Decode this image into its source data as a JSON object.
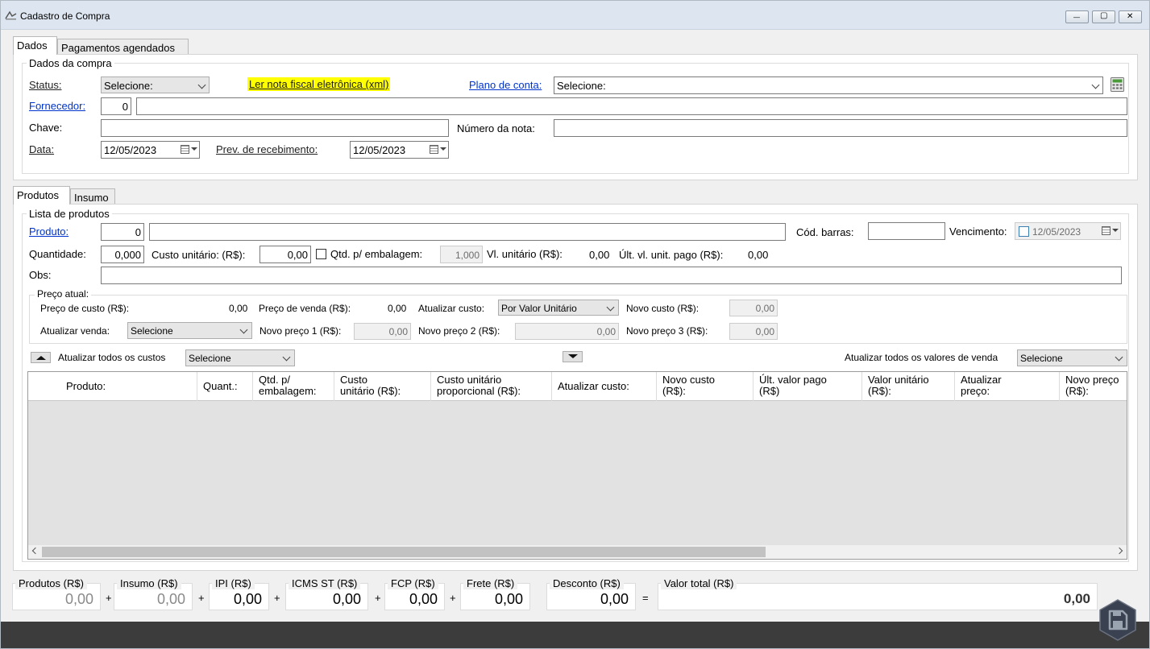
{
  "window": {
    "title": "Cadastro de Compra",
    "minimize_glyph": "—",
    "maximize_glyph": "▢",
    "close_glyph": "✕",
    "icon": "app-logo-icon"
  },
  "tabs_top": [
    "Dados",
    "Pagamentos agendados"
  ],
  "dados_compra": {
    "legend": "Dados da compra",
    "status_label": "Status:",
    "status_value": "Selecione:",
    "xml_link": "Ler nota fiscal eletrônica (xml)",
    "xml_highlight_color": "#ffff00",
    "plano_label": "Plano de conta:",
    "plano_value": "Selecione:",
    "fornecedor_label": "Fornecedor:",
    "fornecedor_code": "0",
    "fornecedor_name": "",
    "chave_label": "Chave:",
    "chave_value": "",
    "numero_label": "Número da nota:",
    "numero_value": "",
    "data_label": "Data:",
    "data_value": "12/05/2023",
    "prev_label": "Prev. de recebimento:",
    "prev_value": "12/05/2023"
  },
  "tabs_products": [
    "Produtos",
    "Insumo"
  ],
  "lista": {
    "legend": "Lista de produtos",
    "produto_label": "Produto:",
    "produto_code": "0",
    "produto_name": "",
    "cod_barras_label": "Cód. barras:",
    "cod_barras_value": "",
    "vencimento_label": "Vencimento:",
    "vencimento_value": "12/05/2023",
    "quantidade_label": "Quantidade:",
    "quantidade_value": "0,000",
    "custo_label": "Custo unitário: (R$):",
    "custo_value": "0,00",
    "qtd_emb_label": "Qtd. p/ embalagem:",
    "qtd_emb_value": "1,000",
    "vl_unit_label": "Vl. unitário (R$):",
    "vl_unit_value": "0,00",
    "ult_vl_label": "Últ. vl. unit. pago (R$):",
    "ult_vl_value": "0,00",
    "obs_label": "Obs:",
    "obs_value": ""
  },
  "preco_atual": {
    "legend": "Preço atual:",
    "preco_custo_label": "Preço de custo (R$):",
    "preco_custo_value": "0,00",
    "preco_venda_label": "Preço de venda (R$):",
    "preco_venda_value": "0,00",
    "atualizar_custo_label": "Atualizar custo:",
    "atualizar_custo_value": "Por Valor Unitário",
    "novo_custo_label": "Novo custo (R$):",
    "novo_custo_value": "0,00",
    "atualizar_venda_label": "Atualizar venda:",
    "atualizar_venda_value": "Selecione",
    "novo_preco1_label": "Novo preço 1 (R$):",
    "novo_preco1_value": "0,00",
    "novo_preco2_label": "Novo preço 2 (R$):",
    "novo_preco2_value": "0,00",
    "novo_preco3_label": "Novo preço 3 (R$):",
    "novo_preco3_value": "0,00"
  },
  "bulk": {
    "atualizar_custos_label": "Atualizar todos os custos",
    "atualizar_custos_value": "Selecione",
    "atualizar_valores_label": "Atualizar todos os valores de venda",
    "atualizar_valores_value": "Selecione"
  },
  "grid": {
    "columns": [
      [
        "Produto:"
      ],
      [
        "Quant.:"
      ],
      [
        "Qtd. p/",
        "embalagem:"
      ],
      [
        "Custo",
        "unitário (R$):"
      ],
      [
        "Custo unitário",
        "proporcional (R$):"
      ],
      [
        "Atualizar custo:"
      ],
      [
        "Novo custo",
        "(R$):"
      ],
      [
        "Últ. valor pago",
        "(R$)"
      ],
      [
        "Valor unitário",
        "(R$):"
      ],
      [
        "Atualizar",
        "preço:"
      ],
      [
        "Novo preço",
        "(R$):"
      ]
    ],
    "rows": []
  },
  "totals": {
    "produtos_label": "Produtos (R$)",
    "produtos_value": "0,00",
    "insumo_label": "Insumo (R$)",
    "insumo_value": "0,00",
    "ipi_label": "IPI (R$)",
    "ipi_value": "0,00",
    "icms_label": "ICMS ST (R$)",
    "icms_value": "0,00",
    "fcp_label": "FCP (R$)",
    "fcp_value": "0,00",
    "frete_label": "Frete (R$)",
    "frete_value": "0,00",
    "desconto_label": "Desconto (R$)",
    "desconto_value": "0,00",
    "total_label": "Valor total (R$)",
    "total_value": "0,00",
    "plus": "+",
    "equals": "="
  },
  "colors": {
    "link": "#0033cc",
    "statusbar": "#3c3c3c",
    "save_button": "#3a4150"
  }
}
